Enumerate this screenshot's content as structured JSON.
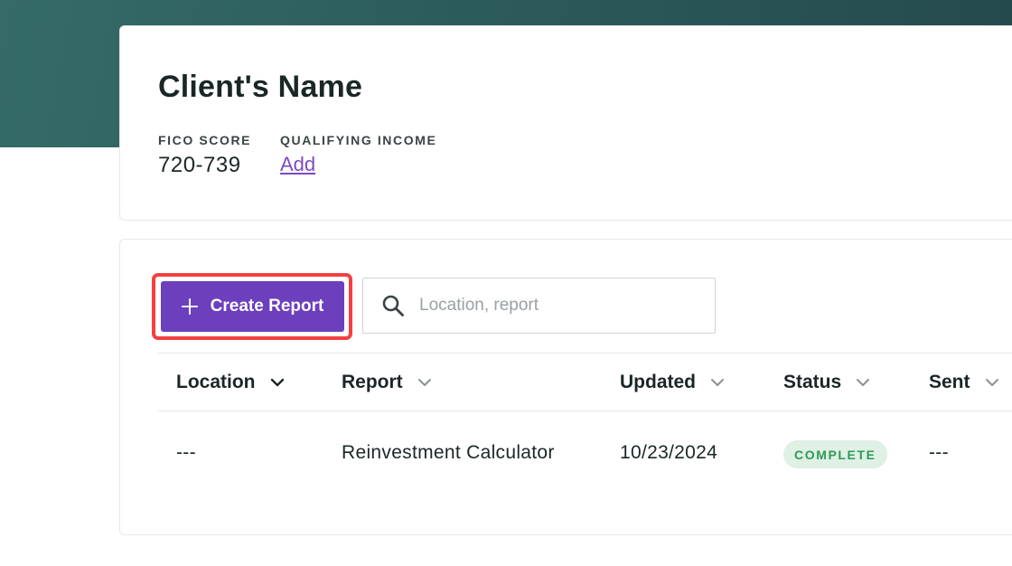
{
  "client": {
    "name": "Client's Name",
    "fico_label": "FICO SCORE",
    "fico_value": "720-739",
    "income_label": "QUALIFYING INCOME",
    "income_action": "Add"
  },
  "toolbar": {
    "create_label": "Create Report",
    "search_placeholder": "Location, report",
    "search_value": ""
  },
  "table": {
    "columns": [
      "Location",
      "Report",
      "Updated",
      "Status",
      "Sent"
    ],
    "rows": [
      {
        "location": "---",
        "report": "Reinvestment Calculator",
        "updated": "10/23/2024",
        "status": "COMPLETE",
        "sent": "---"
      }
    ]
  },
  "colors": {
    "brand_purple": "#6c3fbd",
    "highlight_red": "#f2413f",
    "header_teal": "#2c5c5a",
    "status_complete_bg": "#dff0e5",
    "status_complete_text": "#2f9a57"
  },
  "icons": {
    "create": "plus-icon",
    "search": "search-icon",
    "sort": "chevron-down-icon"
  }
}
